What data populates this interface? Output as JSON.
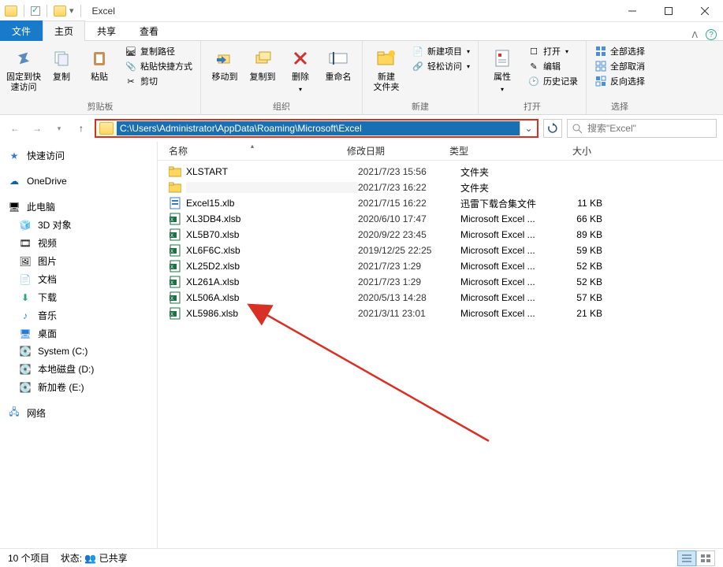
{
  "window": {
    "title": "Excel"
  },
  "tabs": {
    "file": "文件",
    "home": "主页",
    "share": "共享",
    "view": "查看"
  },
  "ribbon": {
    "clipboard": {
      "pin": "固定到快\n速访问",
      "copy": "复制",
      "paste": "粘贴",
      "copy_path": "复制路径",
      "paste_shortcut": "粘贴快捷方式",
      "cut": "剪切",
      "label": "剪贴板"
    },
    "organize": {
      "move_to": "移动到",
      "copy_to": "复制到",
      "delete": "删除",
      "rename": "重命名",
      "label": "组织"
    },
    "new": {
      "new_folder": "新建\n文件夹",
      "new_item": "新建项目",
      "easy_access": "轻松访问",
      "label": "新建"
    },
    "open": {
      "properties": "属性",
      "open": "打开",
      "edit": "编辑",
      "history": "历史记录",
      "label": "打开"
    },
    "select": {
      "select_all": "全部选择",
      "select_none": "全部取消",
      "invert": "反向选择",
      "label": "选择"
    }
  },
  "address": {
    "path": "C:\\Users\\Administrator\\AppData\\Roaming\\Microsoft\\Excel"
  },
  "search": {
    "placeholder": "搜索\"Excel\""
  },
  "sidebar": {
    "quick_access": "快速访问",
    "onedrive": "OneDrive",
    "this_pc": "此电脑",
    "objects3d": "3D 对象",
    "videos": "视频",
    "pictures": "图片",
    "documents": "文档",
    "downloads": "下载",
    "music": "音乐",
    "desktop": "桌面",
    "drive_c": "System (C:)",
    "drive_d": "本地磁盘 (D:)",
    "drive_e": "新加卷 (E:)",
    "network": "网络"
  },
  "columns": {
    "name": "名称",
    "date": "修改日期",
    "type": "类型",
    "size": "大小"
  },
  "files": [
    {
      "icon": "folder",
      "name": "XLSTART",
      "date": "2021/7/23 15:56",
      "type": "文件夹",
      "size": ""
    },
    {
      "icon": "folder",
      "name": "",
      "date": "2021/7/23 16:22",
      "type": "文件夹",
      "size": "",
      "redacted": true
    },
    {
      "icon": "xlb",
      "name": "Excel15.xlb",
      "date": "2021/7/15 16:22",
      "type": "迅雷下载合集文件",
      "size": "11 KB"
    },
    {
      "icon": "xlsb",
      "name": "XL3DB4.xlsb",
      "date": "2020/6/10 17:47",
      "type": "Microsoft Excel ...",
      "size": "66 KB"
    },
    {
      "icon": "xlsb",
      "name": "XL5B70.xlsb",
      "date": "2020/9/22 23:45",
      "type": "Microsoft Excel ...",
      "size": "89 KB"
    },
    {
      "icon": "xlsb",
      "name": "XL6F6C.xlsb",
      "date": "2019/12/25 22:25",
      "type": "Microsoft Excel ...",
      "size": "59 KB"
    },
    {
      "icon": "xlsb",
      "name": "XL25D2.xlsb",
      "date": "2021/7/23 1:29",
      "type": "Microsoft Excel ...",
      "size": "52 KB"
    },
    {
      "icon": "xlsb",
      "name": "XL261A.xlsb",
      "date": "2021/7/23 1:29",
      "type": "Microsoft Excel ...",
      "size": "52 KB"
    },
    {
      "icon": "xlsb",
      "name": "XL506A.xlsb",
      "date": "2020/5/13 14:28",
      "type": "Microsoft Excel ...",
      "size": "57 KB"
    },
    {
      "icon": "xlsb",
      "name": "XL5986.xlsb",
      "date": "2021/3/11 23:01",
      "type": "Microsoft Excel ...",
      "size": "21 KB"
    }
  ],
  "status": {
    "count": "10 个项目",
    "state_label": "状态:",
    "shared": "已共享"
  }
}
